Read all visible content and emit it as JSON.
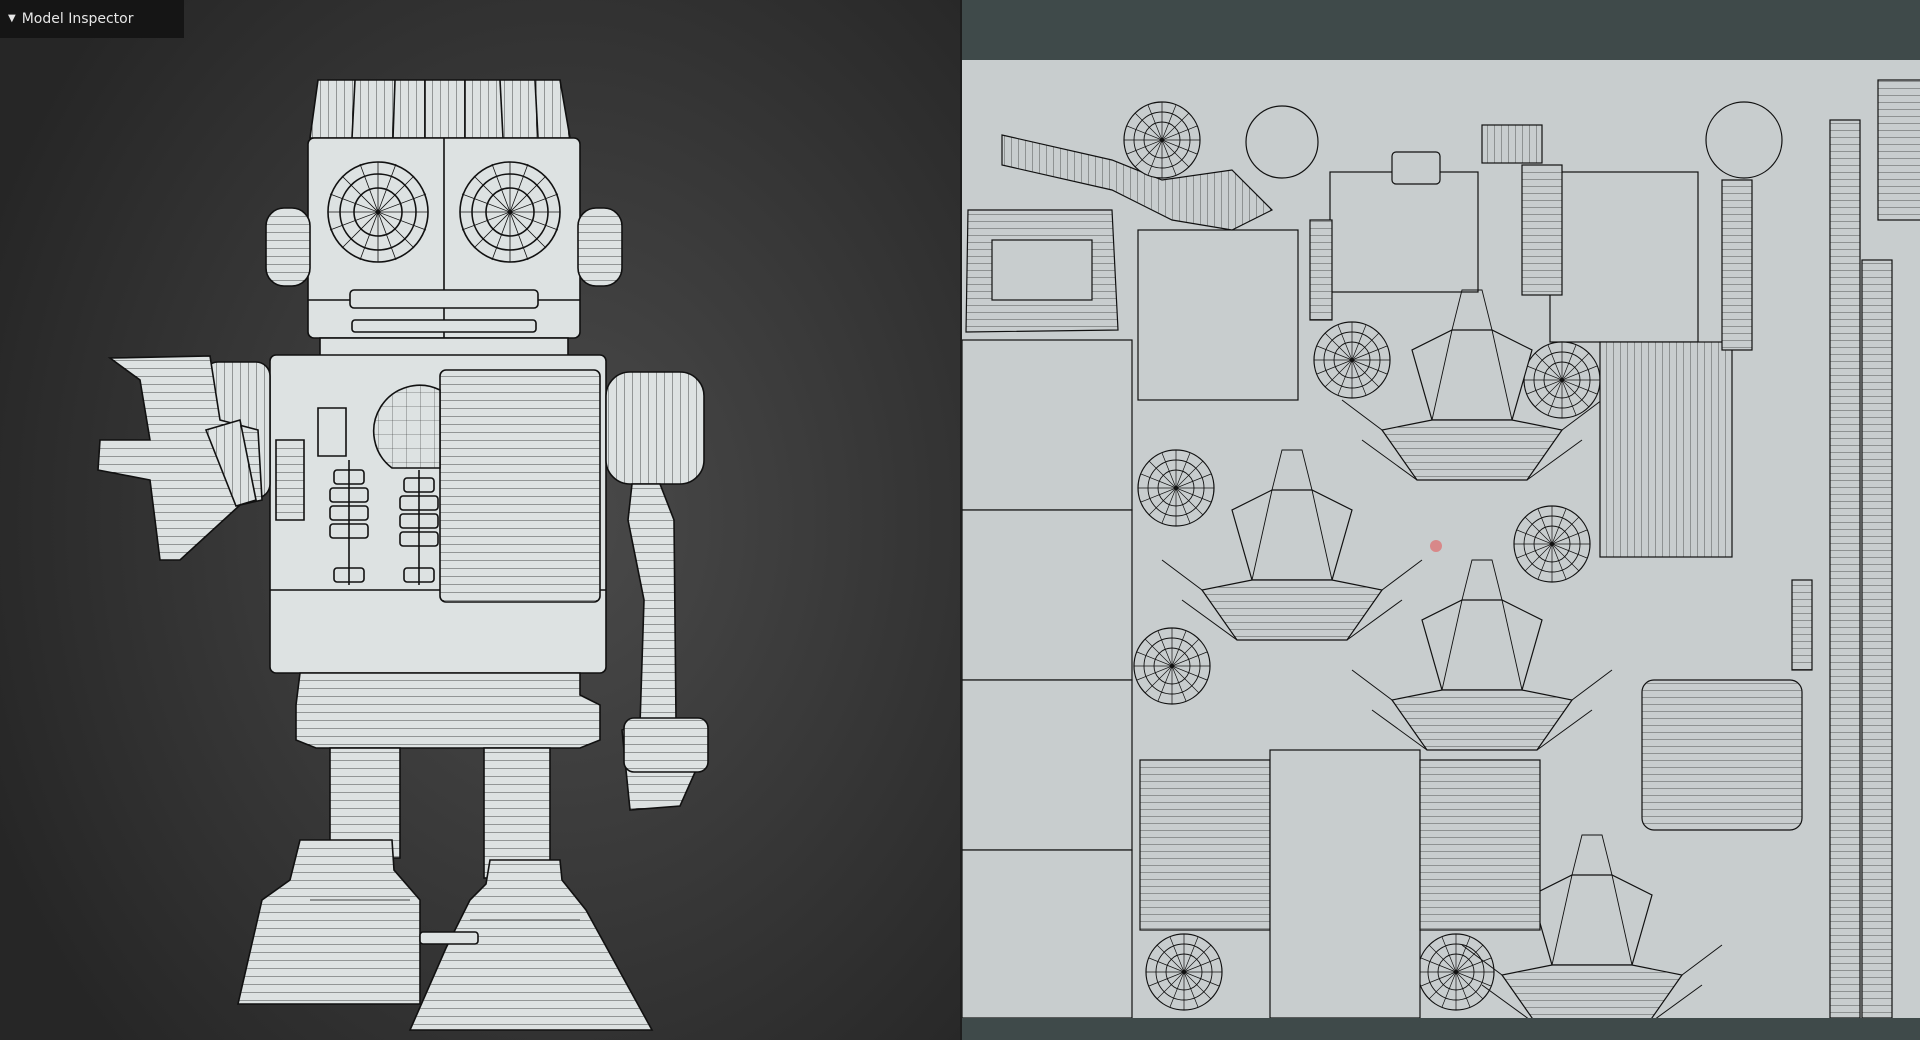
{
  "panel": {
    "title": "Model Inspector",
    "collapse_icon": "triangle-down-icon"
  },
  "viewports": {
    "model": {
      "subject": "wireframe-robot-model"
    },
    "uv": {
      "subject": "uv-layout"
    }
  },
  "colors": {
    "model_fill": "#dde2e2",
    "wire": "#111111",
    "uv_background": "#c8cdce",
    "uv_frame": "#3f4a4a",
    "viewport_bg": "#3a3a3a",
    "cursor": "#e65050"
  }
}
